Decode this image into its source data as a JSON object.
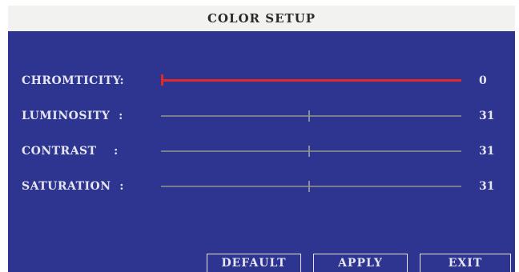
{
  "window": {
    "title": "COLOR SETUP"
  },
  "settings": [
    {
      "label": "CHROMTICITY:",
      "value": "0",
      "level": 0,
      "max": 63,
      "active": true,
      "bar_color": "#e02a2a"
    },
    {
      "label": "LUMINOSITY  :",
      "value": "31",
      "level": 31,
      "max": 63,
      "active": false,
      "bar_color": "#7a7e8a"
    },
    {
      "label": "CONTRAST    :",
      "value": "31",
      "level": 31,
      "max": 63,
      "active": false,
      "bar_color": "#7a7e8a"
    },
    {
      "label": "SATURATION  :",
      "value": "31",
      "level": 31,
      "max": 63,
      "active": false,
      "bar_color": "#7a7e8a"
    }
  ],
  "buttons": {
    "default_label": "DEFAULT",
    "apply_label": "APPLY",
    "exit_label": "EXIT"
  },
  "colors": {
    "background": "#2d3590",
    "titlebar": "#f2f2f0",
    "text": "#e6e6f2",
    "selected": "#e02a2a"
  }
}
